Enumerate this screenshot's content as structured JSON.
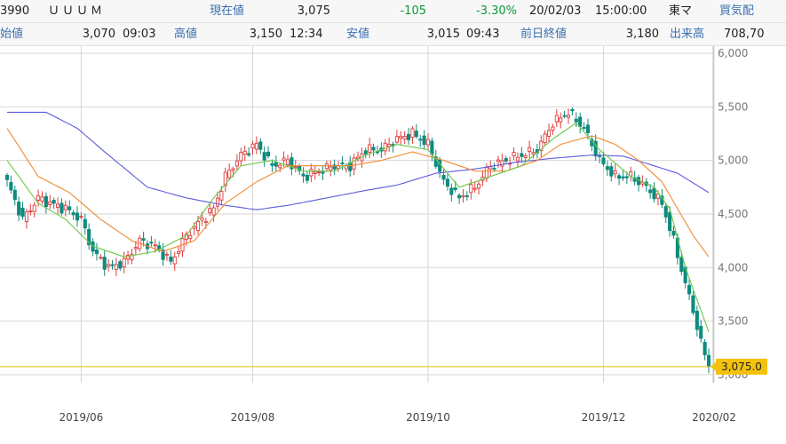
{
  "header": {
    "code": "3990",
    "name": "ＵＵＵＭ",
    "current_label": "現在値",
    "current": "3,075",
    "change": "-105",
    "change_pct": "-3.30%",
    "date": "20/02/03",
    "time": "15:00:00",
    "market": "東マ",
    "buy_label": "買気配",
    "open_label": "始値",
    "open": "3,070",
    "open_time": "09:03",
    "high_label": "高値",
    "high": "3,150",
    "high_time": "12:34",
    "low_label": "安値",
    "low": "3,015",
    "low_time": "09:43",
    "prev_label": "前日終値",
    "prev": "3,180",
    "volume_label": "出来高",
    "volume": "708,70"
  },
  "colors": {
    "up": "#e03c3c",
    "down": "#0f8a7e",
    "ma_short": "#6bc94a",
    "ma_mid": "#f08a32",
    "ma_long": "#5c5cdc",
    "price_line": "#d8c400",
    "badge": "#f4c20d"
  },
  "chart_data": {
    "type": "candlestick",
    "xlabel": "",
    "ylabel": "",
    "x_ticks": [
      "2019/06",
      "2019/08",
      "2019/10",
      "2019/12",
      "2020/02"
    ],
    "y_ticks": [
      "6,000",
      "5,500",
      "5,000",
      "4,500",
      "4,000",
      "3,500",
      "3,000"
    ],
    "ylim": [
      2950,
      6000
    ],
    "current_price_label": "3,075.0",
    "current_price": 3075,
    "close_keypoints": [
      [
        0,
        4800
      ],
      [
        4,
        4450
      ],
      [
        8,
        4650
      ],
      [
        11,
        4600
      ],
      [
        15,
        4550
      ],
      [
        19,
        4450
      ],
      [
        22,
        4150
      ],
      [
        26,
        4000
      ],
      [
        30,
        4050
      ],
      [
        34,
        4250
      ],
      [
        38,
        4200
      ],
      [
        42,
        4050
      ],
      [
        46,
        4300
      ],
      [
        50,
        4450
      ],
      [
        53,
        4550
      ],
      [
        56,
        4850
      ],
      [
        60,
        5050
      ],
      [
        64,
        5150
      ],
      [
        68,
        4950
      ],
      [
        72,
        5000
      ],
      [
        76,
        4850
      ],
      [
        80,
        4900
      ],
      [
        84,
        4950
      ],
      [
        88,
        4950
      ],
      [
        92,
        5100
      ],
      [
        96,
        5100
      ],
      [
        100,
        5200
      ],
      [
        104,
        5250
      ],
      [
        108,
        5150
      ],
      [
        112,
        4800
      ],
      [
        116,
        4650
      ],
      [
        120,
        4750
      ],
      [
        124,
        4950
      ],
      [
        128,
        5000
      ],
      [
        132,
        5050
      ],
      [
        136,
        5100
      ],
      [
        140,
        5350
      ],
      [
        144,
        5450
      ],
      [
        148,
        5300
      ],
      [
        152,
        5000
      ],
      [
        156,
        4850
      ],
      [
        160,
        4850
      ],
      [
        164,
        4750
      ],
      [
        168,
        4600
      ],
      [
        171,
        4250
      ],
      [
        174,
        3850
      ],
      [
        176,
        3600
      ],
      [
        178,
        3300
      ],
      [
        180,
        3075
      ]
    ],
    "ma_short_keypoints": [
      [
        0,
        5000
      ],
      [
        8,
        4600
      ],
      [
        15,
        4450
      ],
      [
        22,
        4200
      ],
      [
        30,
        4100
      ],
      [
        38,
        4150
      ],
      [
        46,
        4300
      ],
      [
        53,
        4650
      ],
      [
        60,
        4950
      ],
      [
        68,
        5000
      ],
      [
        76,
        4900
      ],
      [
        84,
        4900
      ],
      [
        92,
        5050
      ],
      [
        100,
        5150
      ],
      [
        108,
        5100
      ],
      [
        116,
        4750
      ],
      [
        124,
        4850
      ],
      [
        132,
        4950
      ],
      [
        140,
        5200
      ],
      [
        146,
        5350
      ],
      [
        152,
        5100
      ],
      [
        160,
        4850
      ],
      [
        166,
        4750
      ],
      [
        170,
        4550
      ],
      [
        174,
        4000
      ],
      [
        177,
        3700
      ],
      [
        180,
        3400
      ]
    ],
    "ma_mid_keypoints": [
      [
        0,
        5300
      ],
      [
        8,
        4850
      ],
      [
        16,
        4700
      ],
      [
        24,
        4450
      ],
      [
        32,
        4250
      ],
      [
        40,
        4150
      ],
      [
        48,
        4250
      ],
      [
        56,
        4600
      ],
      [
        64,
        4800
      ],
      [
        72,
        4950
      ],
      [
        80,
        4950
      ],
      [
        88,
        4950
      ],
      [
        96,
        5000
      ],
      [
        104,
        5080
      ],
      [
        112,
        5000
      ],
      [
        120,
        4900
      ],
      [
        128,
        4900
      ],
      [
        136,
        5000
      ],
      [
        142,
        5150
      ],
      [
        150,
        5230
      ],
      [
        156,
        5150
      ],
      [
        162,
        5000
      ],
      [
        168,
        4800
      ],
      [
        172,
        4550
      ],
      [
        176,
        4300
      ],
      [
        180,
        4100
      ]
    ],
    "ma_long_keypoints": [
      [
        0,
        5450
      ],
      [
        10,
        5450
      ],
      [
        18,
        5300
      ],
      [
        26,
        5050
      ],
      [
        36,
        4750
      ],
      [
        46,
        4650
      ],
      [
        56,
        4580
      ],
      [
        64,
        4540
      ],
      [
        72,
        4580
      ],
      [
        82,
        4650
      ],
      [
        92,
        4720
      ],
      [
        100,
        4770
      ],
      [
        110,
        4880
      ],
      [
        120,
        4920
      ],
      [
        130,
        4980
      ],
      [
        140,
        5020
      ],
      [
        150,
        5050
      ],
      [
        158,
        5040
      ],
      [
        166,
        4950
      ],
      [
        172,
        4880
      ],
      [
        180,
        4700
      ]
    ]
  }
}
